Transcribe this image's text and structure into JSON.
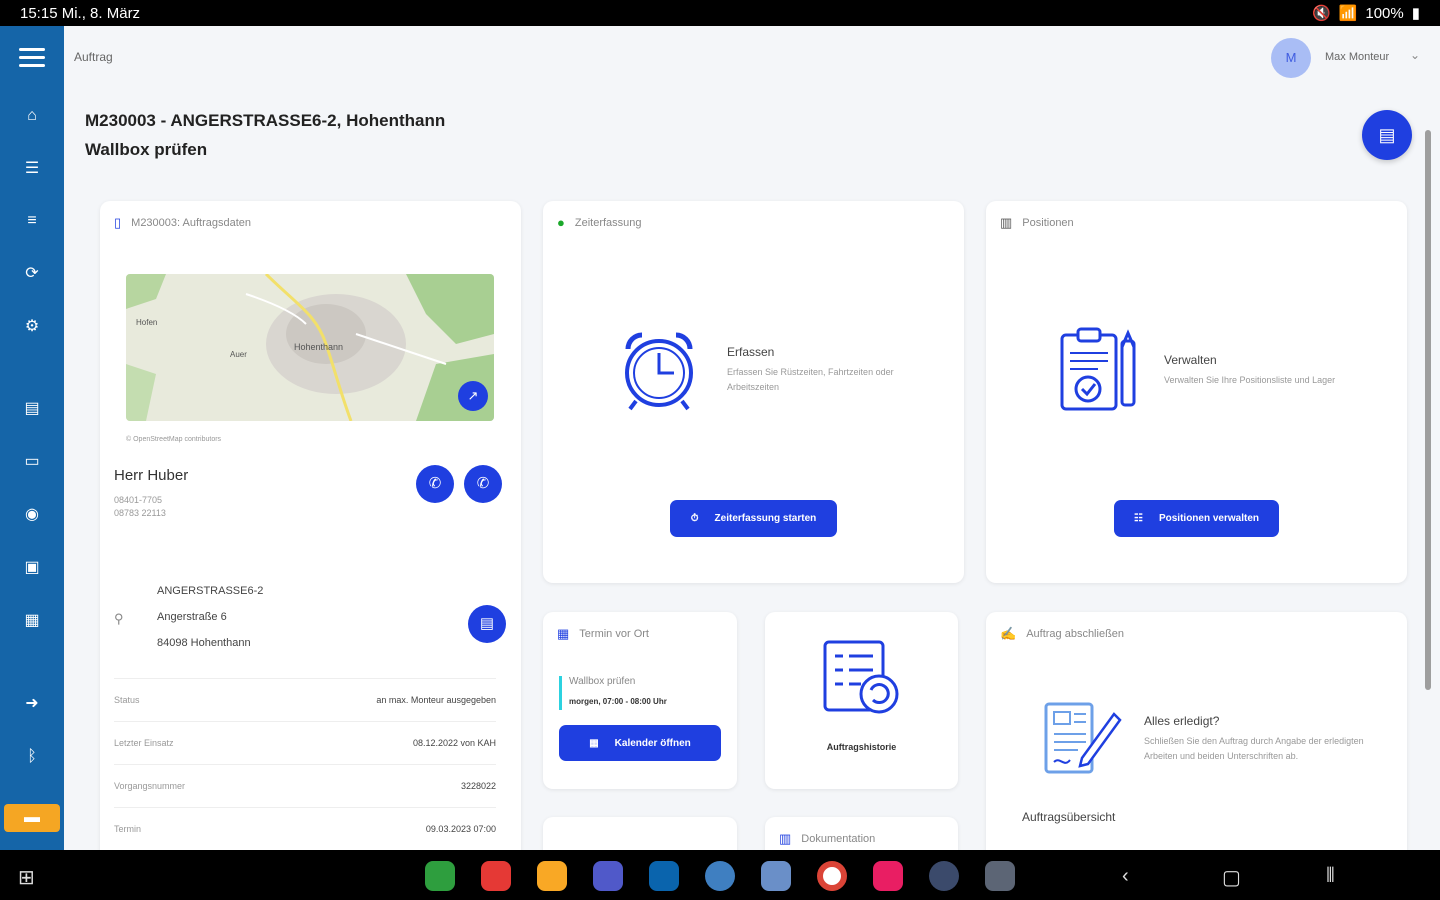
{
  "status_bar": {
    "time": "15:15",
    "date": "Mi., 8. März",
    "battery": "100%"
  },
  "app": {
    "breadcrumb": "Auftrag",
    "user_initial": "M",
    "user_name": "Max Monteur"
  },
  "order": {
    "title": "M230003 - ANGERSTRASSE6-2, Hohenthann",
    "subtitle": "Wallbox prüfen"
  },
  "details_card": {
    "header": "M230003: Auftragsdaten",
    "map_attribution": "© OpenStreetMap contributors",
    "map_labels": [
      "Hofen",
      "Hohenthann",
      "Auer"
    ],
    "contact_name": "Herr Huber",
    "phone1": "08401-7705",
    "phone2": "08783 22113",
    "address_line1": "ANGERSTRASSE6-2",
    "address_line2": "Angerstraße 6",
    "address_line3": "84098 Hohenthann",
    "rows": [
      {
        "label": "Status",
        "value": "an max. Monteur ausgegeben"
      },
      {
        "label": "Letzter Einsatz",
        "value": "08.12.2022 von KAH"
      },
      {
        "label": "Vorgangsnummer",
        "value": "3228022"
      },
      {
        "label": "Termin",
        "value": "09.03.2023 07:00"
      }
    ]
  },
  "time_card": {
    "header": "Zeiterfassung",
    "title": "Erfassen",
    "desc": "Erfassen Sie Rüstzeiten, Fahrtzeiten oder Arbeitszeiten",
    "button": "Zeiterfassung starten"
  },
  "positions_card": {
    "header": "Positionen",
    "title": "Verwalten",
    "desc": "Verwalten Sie Ihre Positionsliste und Lager",
    "button": "Positionen verwalten"
  },
  "appointments_card": {
    "header": "Termin vor Ort",
    "entry_title": "Wallbox prüfen",
    "entry_time": "morgen, 07:00 - 08:00 Uhr",
    "button": "Kalender öffnen"
  },
  "history_card": {
    "label": "Auftragshistorie"
  },
  "documentation_card": {
    "header": "Dokumentation"
  },
  "close_card": {
    "header": "Auftrag abschließen",
    "title": "Alles erledigt?",
    "desc": "Schließen Sie den Auftrag durch Angabe der erledigten Arbeiten und beiden Unterschriften ab.",
    "overview_label": "Auftragsübersicht"
  },
  "colors": {
    "primary": "#1f3fe0",
    "rail": "#1565a8",
    "accent": "#f5a623"
  }
}
